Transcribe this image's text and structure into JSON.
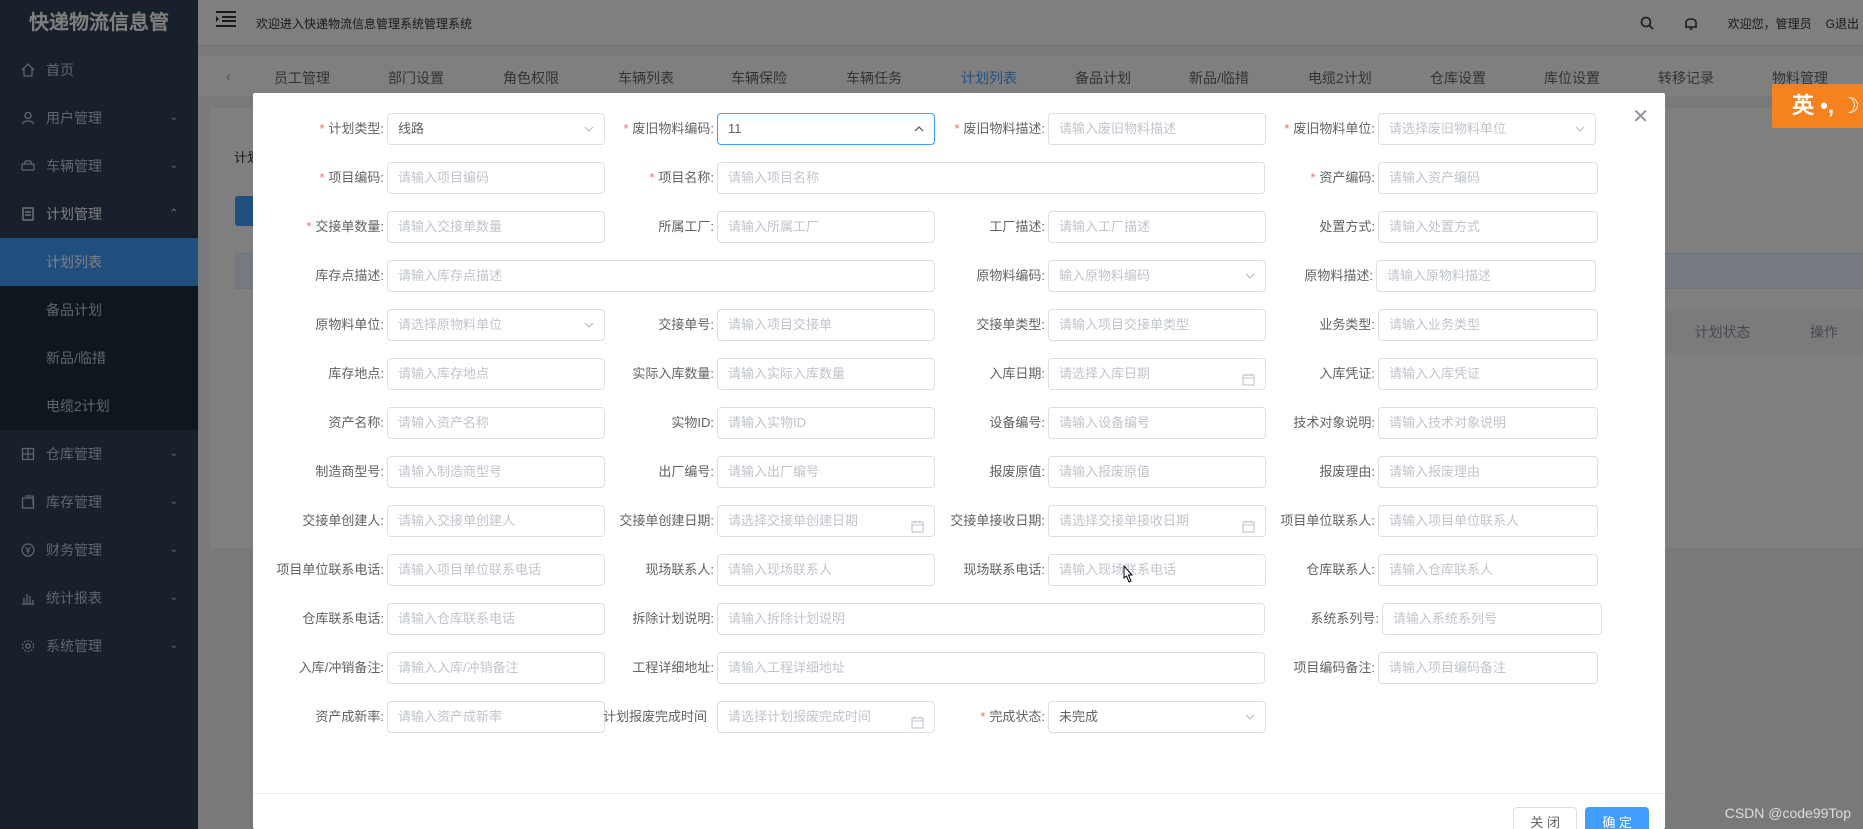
{
  "sidebar": {
    "logo": "快递物流信息管",
    "items": [
      {
        "icon": "home-icon",
        "label": "首页"
      },
      {
        "icon": "user-icon",
        "label": "用户管理"
      },
      {
        "icon": "car-icon",
        "label": "车辆管理"
      },
      {
        "icon": "document-icon",
        "label": "计划管理"
      }
    ],
    "sub_items": [
      "计划列表",
      "备品计划",
      "新品/临措",
      "电缆2计划"
    ],
    "items_after": [
      {
        "icon": "warehouse-icon",
        "label": "仓库管理"
      },
      {
        "icon": "inventory-icon",
        "label": "库存管理"
      },
      {
        "icon": "finance-icon",
        "label": "财务管理"
      },
      {
        "icon": "stats-icon",
        "label": "统计报表"
      },
      {
        "icon": "settings-icon",
        "label": "系统管理"
      }
    ]
  },
  "header": {
    "welcome": "欢迎进入快递物流信息管理系统管理系统",
    "user_greeting": "欢迎您，管理员",
    "logout": "退出"
  },
  "tabs": [
    "员工管理",
    "部门设置",
    "角色权限",
    "车辆列表",
    "车辆保险",
    "车辆任务",
    "计划列表",
    "备品计划",
    "新品/临措",
    "电缆2计划",
    "仓库设置",
    "库位设置",
    "转移记录",
    "物料管理"
  ],
  "active_tab": "计划列表",
  "background": {
    "label_fragment": "计划",
    "table_headers": [
      "计划状态",
      "操作"
    ]
  },
  "ime": {
    "label": "英 •, ☽"
  },
  "form": {
    "f01": {
      "label": "计划类型:",
      "value": "线路",
      "placeholder": ""
    },
    "f02": {
      "label": "废旧物料编码:",
      "value": "11",
      "placeholder": ""
    },
    "f03": {
      "label": "废旧物料描述:",
      "value": "",
      "placeholder": "请输入废旧物料描述"
    },
    "f04": {
      "label": "废旧物料单位:",
      "value": "",
      "placeholder": "请选择废旧物料单位"
    },
    "f05": {
      "label": "项目编码:",
      "value": "",
      "placeholder": "请输入项目编码"
    },
    "f06": {
      "label": "项目名称:",
      "value": "",
      "placeholder": "请输入项目名称"
    },
    "f07": {
      "label": "资产编码:",
      "value": "",
      "placeholder": "请输入资产编码"
    },
    "f08": {
      "label": "交接单数量:",
      "value": "",
      "placeholder": "请输入交接单数量"
    },
    "f09": {
      "label": "所属工厂:",
      "value": "",
      "placeholder": "请输入所属工厂"
    },
    "f10": {
      "label": "工厂描述:",
      "value": "",
      "placeholder": "请输入工厂描述"
    },
    "f11": {
      "label": "处置方式:",
      "value": "",
      "placeholder": "请输入处置方式"
    },
    "f12": {
      "label": "库存点描述:",
      "value": "",
      "placeholder": "请输入库存点描述"
    },
    "f13": {
      "label": "原物料编码:",
      "value": "",
      "placeholder": "输入原物料编码"
    },
    "f14": {
      "label": "原物料描述:",
      "value": "",
      "placeholder": "请输入原物料描述"
    },
    "f15": {
      "label": "原物料单位:",
      "value": "",
      "placeholder": "请选择原物料单位"
    },
    "f16": {
      "label": "交接单号:",
      "value": "",
      "placeholder": "请输入项目交接单"
    },
    "f17": {
      "label": "交接单类型:",
      "value": "",
      "placeholder": "请输入项目交接单类型"
    },
    "f18": {
      "label": "业务类型:",
      "value": "",
      "placeholder": "请输入业务类型"
    },
    "f19": {
      "label": "库存地点:",
      "value": "",
      "placeholder": "请输入库存地点"
    },
    "f20": {
      "label": "实际入库数量:",
      "value": "",
      "placeholder": "请输入实际入库数量"
    },
    "f21": {
      "label": "入库日期:",
      "value": "",
      "placeholder": "请选择入库日期"
    },
    "f22": {
      "label": "入库凭证:",
      "value": "",
      "placeholder": "请输入入库凭证"
    },
    "f23": {
      "label": "资产名称:",
      "value": "",
      "placeholder": "请输入资产名称"
    },
    "f24": {
      "label": "实物ID:",
      "value": "",
      "placeholder": "请输入实物ID"
    },
    "f25": {
      "label": "设备编号:",
      "value": "",
      "placeholder": "请输入设备编号"
    },
    "f26": {
      "label": "技术对象说明:",
      "value": "",
      "placeholder": "请输入技术对象说明"
    },
    "f27": {
      "label": "制造商型号:",
      "value": "",
      "placeholder": "请输入制造商型号"
    },
    "f28": {
      "label": "出厂编号:",
      "value": "",
      "placeholder": "请输入出厂编号"
    },
    "f29": {
      "label": "报废原值:",
      "value": "",
      "placeholder": "请输入报废原值"
    },
    "f30": {
      "label": "报废理由:",
      "value": "",
      "placeholder": "请输入报废理由"
    },
    "f31": {
      "label": "交接单创建人:",
      "value": "",
      "placeholder": "请输入交接单创建人"
    },
    "f32": {
      "label": "交接单创建日期:",
      "value": "",
      "placeholder": "请选择交接单创建日期"
    },
    "f33": {
      "label": "交接单接收日期:",
      "value": "",
      "placeholder": "请选择交接单接收日期"
    },
    "f34": {
      "label": "项目单位联系人:",
      "value": "",
      "placeholder": "请输入项目单位联系人"
    },
    "f35": {
      "label": "项目单位联系电话:",
      "value": "",
      "placeholder": "请输入项目单位联系电话"
    },
    "f36": {
      "label": "现场联系人:",
      "value": "",
      "placeholder": "请输入现场联系人"
    },
    "f37": {
      "label": "现场联系电话:",
      "value": "",
      "placeholder": "请输入现场联系电话"
    },
    "f38": {
      "label": "仓库联系人:",
      "value": "",
      "placeholder": "请输入仓库联系人"
    },
    "f39": {
      "label": "仓库联系电话:",
      "value": "",
      "placeholder": "请输入仓库联系电话"
    },
    "f40": {
      "label": "拆除计划说明:",
      "value": "",
      "placeholder": "请输入拆除计划说明"
    },
    "f41": {
      "label": "系统系列号:",
      "value": "",
      "placeholder": "请输入系统系列号"
    },
    "f42": {
      "label": "入库/冲销备注:",
      "value": "",
      "placeholder": "请输入入库/冲销备注"
    },
    "f43": {
      "label": "工程详细地址:",
      "value": "",
      "placeholder": "请输入工程详细地址"
    },
    "f44": {
      "label": "项目编码备注:",
      "value": "",
      "placeholder": "请输入项目编码备注"
    },
    "f45": {
      "label": "资产成新率:",
      "value": "",
      "placeholder": "请输入资产成新率"
    },
    "f46": {
      "label": "计划报废完成时间",
      "value": "",
      "placeholder": "请选择计划报废完成时间"
    },
    "f47": {
      "label": "完成状态:",
      "value": "未完成",
      "placeholder": ""
    }
  },
  "buttons": {
    "cancel": "关 闭",
    "confirm": "确 定"
  },
  "watermark": "CSDN @code99Top",
  "colors": {
    "primary": "#409eff",
    "sidebar": "#304156",
    "required": "#f56c6c",
    "ime": "#f5821f"
  }
}
